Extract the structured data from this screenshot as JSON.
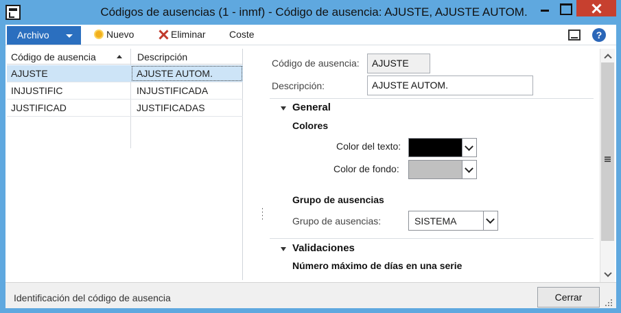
{
  "window": {
    "title": "Códigos de ausencias (1 - inmf) - Código de ausencia: AJUSTE, AJUSTE AUTOM."
  },
  "toolbar": {
    "archivo_label": "Archivo",
    "nuevo_label": "Nuevo",
    "eliminar_label": "Eliminar",
    "coste_label": "Coste"
  },
  "grid": {
    "columns": [
      "Código de ausencia",
      "Descripción"
    ],
    "rows": [
      {
        "code": "AJUSTE",
        "description": "AJUSTE AUTOM."
      },
      {
        "code": "INJUSTIFIC",
        "description": "INJUSTIFICADA"
      },
      {
        "code": "JUSTIFICAD",
        "description": "JUSTIFICADAS"
      }
    ]
  },
  "detail": {
    "code_label": "Código de ausencia:",
    "code_value": "AJUSTE",
    "desc_label": "Descripción:",
    "desc_value": "AJUSTE AUTOM.",
    "general_title": "General",
    "colores_title": "Colores",
    "text_color_label": "Color del texto:",
    "text_color": "#000000",
    "bg_color_label": "Color de fondo:",
    "bg_color": "#c0c0c0",
    "grupo_title": "Grupo de ausencias",
    "grupo_label": "Grupo de ausencias:",
    "grupo_value": "SISTEMA",
    "validaciones_title": "Validaciones",
    "max_days_title": "Número máximo de días en una serie"
  },
  "status": {
    "text": "Identificación del código de ausencia",
    "close_label": "Cerrar"
  },
  "colors": {
    "titlebar": "#5fa8df",
    "accent": "#2b6fbf",
    "selection": "#cde4f7",
    "close": "#c7402f"
  }
}
